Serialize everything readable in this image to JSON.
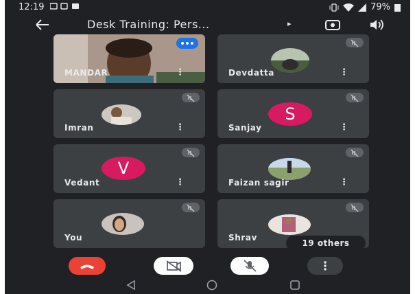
{
  "status_bar": {
    "time": "12:19",
    "battery": "79%"
  },
  "header": {
    "title": "Desk Training: Pers...",
    "caret": "▸"
  },
  "participants": [
    {
      "name": "MANDAR"
    },
    {
      "name": "Devdatta"
    },
    {
      "name": "Imran"
    },
    {
      "name": "Sanjay",
      "initial": "S"
    },
    {
      "name": "Vedant",
      "initial": "V"
    },
    {
      "name": "Faizan sagir"
    },
    {
      "name": "You"
    },
    {
      "name": "Shrav"
    }
  ],
  "others_label": "19 others",
  "more_glyph": "⋮",
  "colors": {
    "background": "#202124",
    "tile": "#3c4043",
    "end_call": "#ea4335",
    "avatar_pink": "#d81b60",
    "speaking": "#1a73e8"
  }
}
